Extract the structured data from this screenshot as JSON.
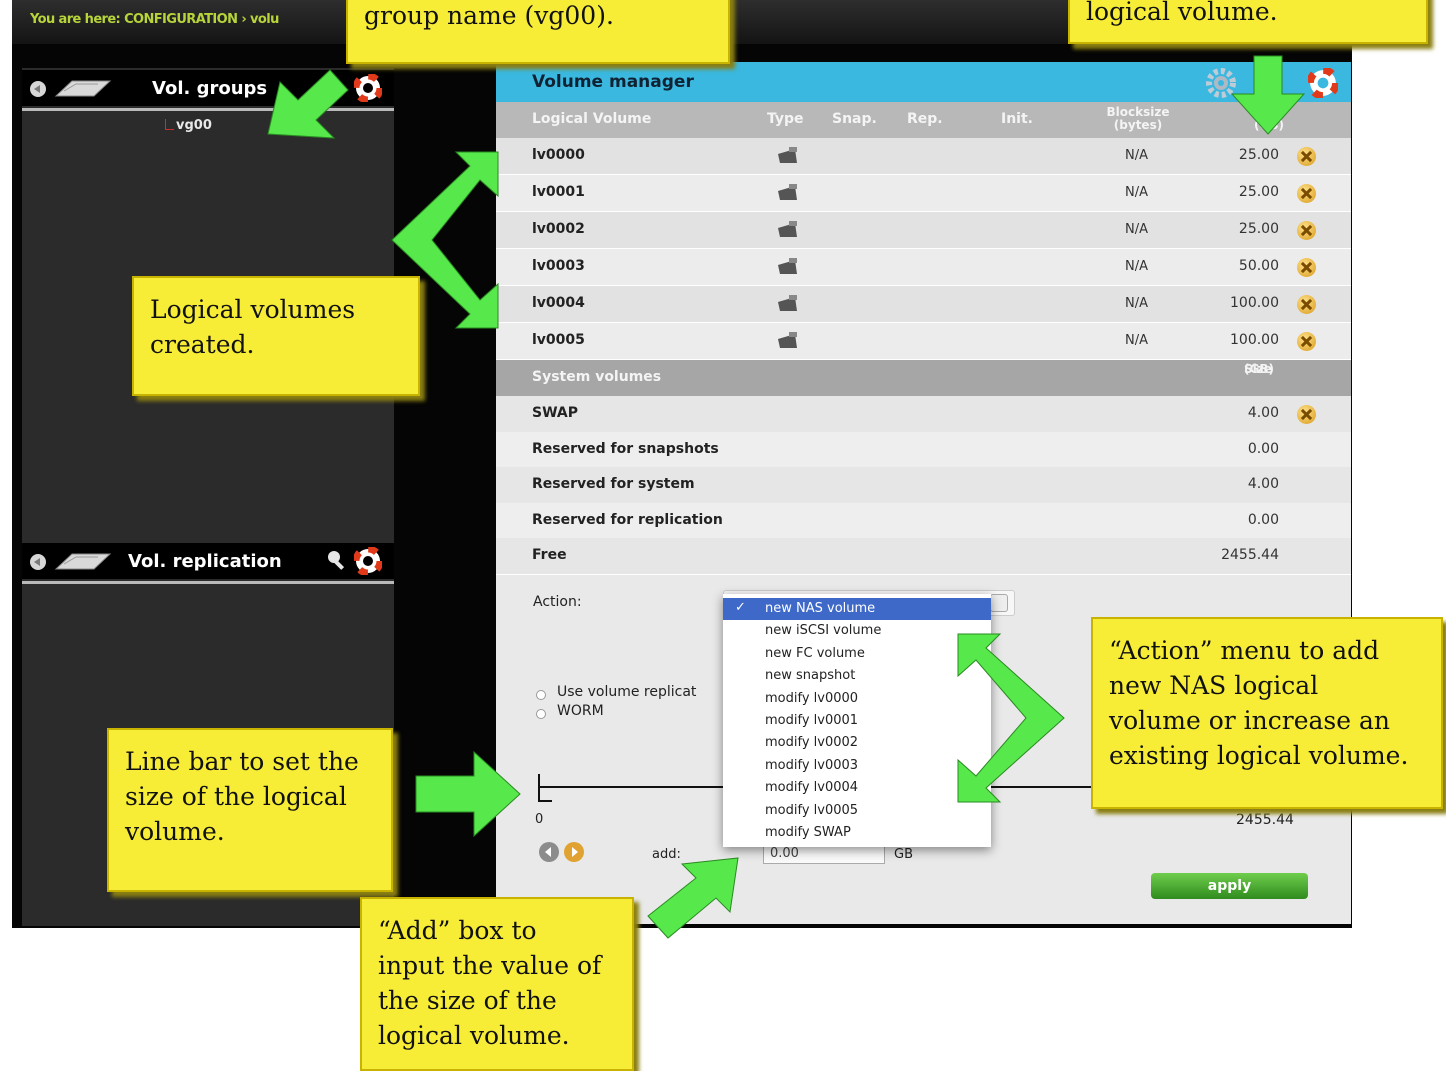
{
  "breadcrumb": "You are here: CONFIGURATION › volu",
  "vol_groups_panel": {
    "title": "Vol. groups",
    "group": "vg00"
  },
  "vol_replication_panel": {
    "title": "Vol. replication"
  },
  "volume_manager": {
    "title": "Volume manager",
    "columns": {
      "logical_volume": "Logical Volume",
      "type": "Type",
      "snap": "Snap.",
      "rep": "Rep.",
      "init": "Init.",
      "blocksize_1": "Blocksize",
      "blocksize_2": "(bytes)",
      "size_1": "Size",
      "size_2": "(GB)"
    },
    "logical_volumes": [
      {
        "name": "lv0000",
        "blocksize": "N/A",
        "size": "25.00"
      },
      {
        "name": "lv0001",
        "blocksize": "N/A",
        "size": "25.00"
      },
      {
        "name": "lv0002",
        "blocksize": "N/A",
        "size": "25.00"
      },
      {
        "name": "lv0003",
        "blocksize": "N/A",
        "size": "50.00"
      },
      {
        "name": "lv0004",
        "blocksize": "N/A",
        "size": "100.00"
      },
      {
        "name": "lv0005",
        "blocksize": "N/A",
        "size": "100.00"
      }
    ],
    "system_header": {
      "label": "System volumes",
      "size_1": "Size",
      "size_2": "(GB)"
    },
    "system_volumes": [
      {
        "name": "SWAP",
        "size": "4.00"
      },
      {
        "name": "Reserved for snapshots",
        "size": "0.00"
      },
      {
        "name": "Reserved for system",
        "size": "4.00"
      },
      {
        "name": "Reserved for replication",
        "size": "0.00"
      },
      {
        "name": "Free",
        "size": "2455.44"
      }
    ],
    "action_label": "Action:",
    "action_options": [
      "new NAS volume",
      "new iSCSI volume",
      "new FC volume",
      "new snapshot",
      "modify lv0000",
      "modify lv0001",
      "modify lv0002",
      "modify lv0003",
      "modify lv0004",
      "modify lv0005",
      "modify SWAP"
    ],
    "selected_check": "✓",
    "options_checkboxes": [
      "Use volume replicat",
      "WORM"
    ],
    "slider": {
      "min": "0",
      "max": "2455.44",
      "value": 0
    },
    "add_label": "add:",
    "add_value": "0.00",
    "unit": "GB",
    "apply": "apply"
  },
  "callouts": {
    "top_left": "group name (vg00).",
    "top_right": "logical volume.",
    "logical_volumes": "Logical volumes\ncreated.",
    "line_bar": "Line bar to set the\nsize of the logical\nvolume.",
    "action_menu": "“Action” menu to add\nnew NAS logical\nvolume or increase an\nexisting logical volume.",
    "add_box": "“Add” box to\ninput the value of\nthe size of the\nlogical volume."
  },
  "colors": {
    "accent_bar": "#3ab8e0",
    "callout": "#f7ed37",
    "arrow": "#57e84b",
    "apply": "#3f9d2a"
  }
}
